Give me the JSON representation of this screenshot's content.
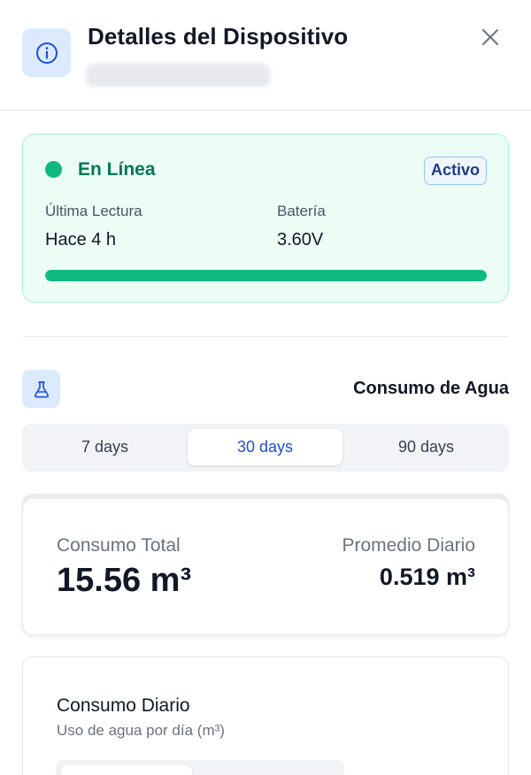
{
  "header": {
    "title": "Detalles del Dispositivo",
    "icons": {
      "info": "info-icon",
      "close": "close-icon"
    }
  },
  "status": {
    "state": "En Línea",
    "badge": "Activo",
    "last_reading_label": "Última Lectura",
    "last_reading_value": "Hace 4 h",
    "battery_label": "Batería",
    "battery_value": "3.60V",
    "battery_level": 1.0,
    "colors": {
      "online": "#10b981",
      "badge_text": "#1e3a8a"
    }
  },
  "consumption": {
    "icon": "flask-icon",
    "title": "Consumo de Agua",
    "ranges": [
      {
        "label": "7 days",
        "active": false
      },
      {
        "label": "30 days",
        "active": true
      },
      {
        "label": "90 days",
        "active": false
      }
    ],
    "summary": {
      "total_label": "Consumo Total",
      "total_value": "15.56 m³",
      "avg_label": "Promedio Diario",
      "avg_value": "0.519 m³"
    },
    "daily": {
      "title": "Consumo Diario",
      "subtitle": "Uso de agua por día (m³)"
    }
  }
}
